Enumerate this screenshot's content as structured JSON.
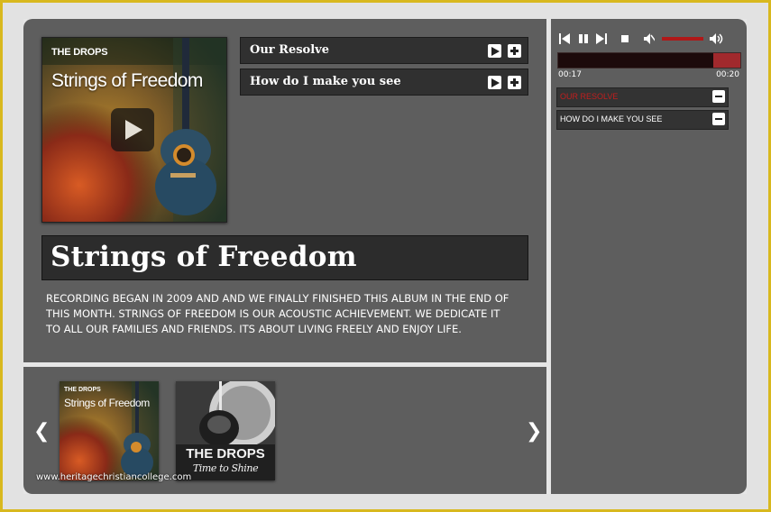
{
  "album": {
    "band": "THE DROPS",
    "title": "Strings of Freedom",
    "description": "RECORDING BEGAN IN 2009 AND AND WE FINALLY FINISHED THIS ALBUM IN THE END OF THIS MONTH. STRINGS OF FREEDOM IS OUR ACOUSTIC ACHIEVEMENT. WE DEDICATE IT TO ALL OUR FAMILIES AND FRIENDS. ITS ABOUT LIVING FREELY AND ENJOY LIFE."
  },
  "tracks": [
    {
      "name": "Our Resolve"
    },
    {
      "name": "How do I make you see"
    }
  ],
  "thumbnails": [
    {
      "band": "THE DROPS",
      "title": "Strings of Freedom"
    },
    {
      "band": "THE DROPS",
      "title": "Time to Shine"
    }
  ],
  "watermark": "www.heritagechristiancollege.com",
  "player": {
    "current_time": "00:17",
    "total_time": "00:20",
    "progress": 0.15,
    "volume": 1.0,
    "muted": false
  },
  "playlist": [
    {
      "name": "OUR RESOLVE",
      "active": true
    },
    {
      "name": "HOW DO I MAKE YOU SEE",
      "active": false
    }
  ],
  "colors": {
    "frame_border": "#d8b81e",
    "panel": "#5e5e5e",
    "accent_red": "#b01818",
    "progress_bg": "#1c0a0b",
    "progress_fill": "#a1292d"
  },
  "icons": [
    "play-icon",
    "plus-icon",
    "minus-icon",
    "prev-icon",
    "pause-icon",
    "next-icon",
    "stop-icon",
    "mute-icon",
    "volume-icon",
    "chevron-left-icon",
    "chevron-right-icon"
  ]
}
